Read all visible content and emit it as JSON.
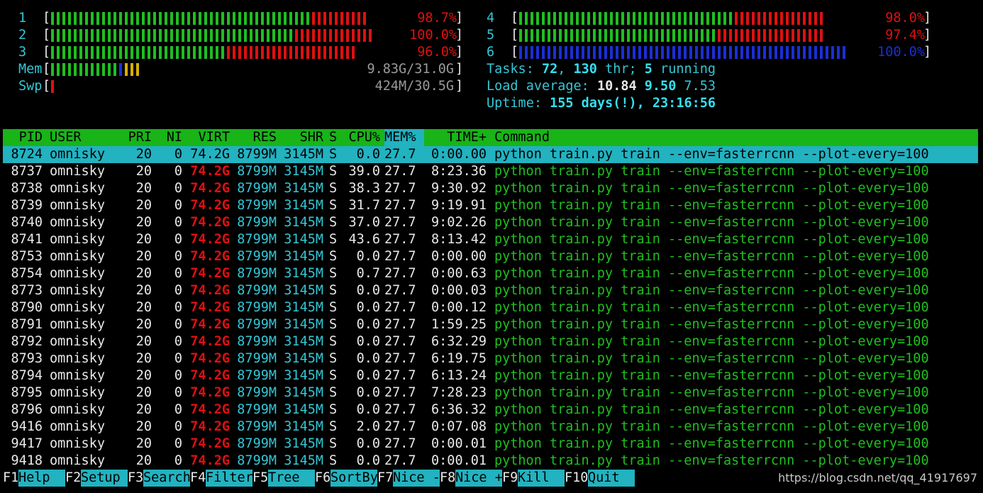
{
  "cpu_meters": [
    {
      "id": "1",
      "value_label": "98.7%",
      "percent": 98.7,
      "green_fraction": 0.81,
      "color_scheme": "green-red"
    },
    {
      "id": "2",
      "value_label": "100.0%",
      "percent": 100.0,
      "green_fraction": 0.76,
      "color_scheme": "green-red"
    },
    {
      "id": "3",
      "value_label": "96.0%",
      "percent": 96.0,
      "green_fraction": 0.55,
      "color_scheme": "green-red"
    },
    {
      "id": "4",
      "value_label": "98.0%",
      "percent": 98.0,
      "green_fraction": 0.69,
      "color_scheme": "green-red"
    },
    {
      "id": "5",
      "value_label": "97.4%",
      "percent": 97.4,
      "green_fraction": 0.63,
      "color_scheme": "green-red"
    },
    {
      "id": "6",
      "value_label": "100.0%",
      "percent": 100.0,
      "green_fraction": 0.0,
      "color_scheme": "blue"
    }
  ],
  "mem": {
    "label": "Mem",
    "value": "9.83G/31.0G",
    "green_fraction": 0.36,
    "blue_fraction": 0.01,
    "yellow_fraction": 0.08
  },
  "swap": {
    "label": "Swp",
    "value": "424M/30.5G",
    "red_fraction": 0.01
  },
  "tasks": {
    "label": "Tasks: ",
    "count": "72",
    "sep1": ", ",
    "threads": "130",
    "thr": " thr; ",
    "running": "5",
    "running_label": " running"
  },
  "load": {
    "label": "Load average: ",
    "l1": "10.84",
    "l5": "9.50",
    "l15": "7.53"
  },
  "uptime": {
    "label": "Uptime: ",
    "value": "155 days(!), 23:16:56"
  },
  "columns": [
    "PID",
    "USER",
    "PRI",
    "NI",
    "VIRT",
    "RES",
    "SHR",
    "S",
    "CPU%",
    "MEM%",
    "TIME+",
    "Command"
  ],
  "sort_column": "MEM%",
  "processes": [
    {
      "pid": "8724",
      "user": "omnisky",
      "pri": "20",
      "ni": "0",
      "virt": "74.2G",
      "res": "8799M",
      "shr": "3145M",
      "s": "S",
      "cpu": "0.0",
      "mem": "27.7",
      "time": "0:00.00",
      "cmd": "python train.py train --env=fasterrcnn --plot-every=100",
      "selected": true
    },
    {
      "pid": "8737",
      "user": "omnisky",
      "pri": "20",
      "ni": "0",
      "virt": "74.2G",
      "res": "8799M",
      "shr": "3145M",
      "s": "S",
      "cpu": "39.0",
      "mem": "27.7",
      "time": "8:23.36",
      "cmd": "python train.py train --env=fasterrcnn --plot-every=100"
    },
    {
      "pid": "8738",
      "user": "omnisky",
      "pri": "20",
      "ni": "0",
      "virt": "74.2G",
      "res": "8799M",
      "shr": "3145M",
      "s": "S",
      "cpu": "38.3",
      "mem": "27.7",
      "time": "9:30.92",
      "cmd": "python train.py train --env=fasterrcnn --plot-every=100"
    },
    {
      "pid": "8739",
      "user": "omnisky",
      "pri": "20",
      "ni": "0",
      "virt": "74.2G",
      "res": "8799M",
      "shr": "3145M",
      "s": "S",
      "cpu": "31.7",
      "mem": "27.7",
      "time": "9:19.91",
      "cmd": "python train.py train --env=fasterrcnn --plot-every=100"
    },
    {
      "pid": "8740",
      "user": "omnisky",
      "pri": "20",
      "ni": "0",
      "virt": "74.2G",
      "res": "8799M",
      "shr": "3145M",
      "s": "S",
      "cpu": "37.0",
      "mem": "27.7",
      "time": "9:02.26",
      "cmd": "python train.py train --env=fasterrcnn --plot-every=100"
    },
    {
      "pid": "8741",
      "user": "omnisky",
      "pri": "20",
      "ni": "0",
      "virt": "74.2G",
      "res": "8799M",
      "shr": "3145M",
      "s": "S",
      "cpu": "43.6",
      "mem": "27.7",
      "time": "8:13.42",
      "cmd": "python train.py train --env=fasterrcnn --plot-every=100"
    },
    {
      "pid": "8753",
      "user": "omnisky",
      "pri": "20",
      "ni": "0",
      "virt": "74.2G",
      "res": "8799M",
      "shr": "3145M",
      "s": "S",
      "cpu": "0.0",
      "mem": "27.7",
      "time": "0:00.00",
      "cmd": "python train.py train --env=fasterrcnn --plot-every=100"
    },
    {
      "pid": "8754",
      "user": "omnisky",
      "pri": "20",
      "ni": "0",
      "virt": "74.2G",
      "res": "8799M",
      "shr": "3145M",
      "s": "S",
      "cpu": "0.7",
      "mem": "27.7",
      "time": "0:00.63",
      "cmd": "python train.py train --env=fasterrcnn --plot-every=100"
    },
    {
      "pid": "8773",
      "user": "omnisky",
      "pri": "20",
      "ni": "0",
      "virt": "74.2G",
      "res": "8799M",
      "shr": "3145M",
      "s": "S",
      "cpu": "0.0",
      "mem": "27.7",
      "time": "0:00.03",
      "cmd": "python train.py train --env=fasterrcnn --plot-every=100"
    },
    {
      "pid": "8790",
      "user": "omnisky",
      "pri": "20",
      "ni": "0",
      "virt": "74.2G",
      "res": "8799M",
      "shr": "3145M",
      "s": "S",
      "cpu": "0.0",
      "mem": "27.7",
      "time": "0:00.12",
      "cmd": "python train.py train --env=fasterrcnn --plot-every=100"
    },
    {
      "pid": "8791",
      "user": "omnisky",
      "pri": "20",
      "ni": "0",
      "virt": "74.2G",
      "res": "8799M",
      "shr": "3145M",
      "s": "S",
      "cpu": "0.0",
      "mem": "27.7",
      "time": "1:59.25",
      "cmd": "python train.py train --env=fasterrcnn --plot-every=100"
    },
    {
      "pid": "8792",
      "user": "omnisky",
      "pri": "20",
      "ni": "0",
      "virt": "74.2G",
      "res": "8799M",
      "shr": "3145M",
      "s": "S",
      "cpu": "0.0",
      "mem": "27.7",
      "time": "6:32.29",
      "cmd": "python train.py train --env=fasterrcnn --plot-every=100"
    },
    {
      "pid": "8793",
      "user": "omnisky",
      "pri": "20",
      "ni": "0",
      "virt": "74.2G",
      "res": "8799M",
      "shr": "3145M",
      "s": "S",
      "cpu": "0.0",
      "mem": "27.7",
      "time": "6:19.75",
      "cmd": "python train.py train --env=fasterrcnn --plot-every=100"
    },
    {
      "pid": "8794",
      "user": "omnisky",
      "pri": "20",
      "ni": "0",
      "virt": "74.2G",
      "res": "8799M",
      "shr": "3145M",
      "s": "S",
      "cpu": "0.0",
      "mem": "27.7",
      "time": "6:13.24",
      "cmd": "python train.py train --env=fasterrcnn --plot-every=100"
    },
    {
      "pid": "8795",
      "user": "omnisky",
      "pri": "20",
      "ni": "0",
      "virt": "74.2G",
      "res": "8799M",
      "shr": "3145M",
      "s": "S",
      "cpu": "0.0",
      "mem": "27.7",
      "time": "7:28.23",
      "cmd": "python train.py train --env=fasterrcnn --plot-every=100"
    },
    {
      "pid": "8796",
      "user": "omnisky",
      "pri": "20",
      "ni": "0",
      "virt": "74.2G",
      "res": "8799M",
      "shr": "3145M",
      "s": "S",
      "cpu": "0.0",
      "mem": "27.7",
      "time": "6:36.32",
      "cmd": "python train.py train --env=fasterrcnn --plot-every=100"
    },
    {
      "pid": "9416",
      "user": "omnisky",
      "pri": "20",
      "ni": "0",
      "virt": "74.2G",
      "res": "8799M",
      "shr": "3145M",
      "s": "S",
      "cpu": "2.0",
      "mem": "27.7",
      "time": "0:07.08",
      "cmd": "python train.py train --env=fasterrcnn --plot-every=100"
    },
    {
      "pid": "9417",
      "user": "omnisky",
      "pri": "20",
      "ni": "0",
      "virt": "74.2G",
      "res": "8799M",
      "shr": "3145M",
      "s": "S",
      "cpu": "0.0",
      "mem": "27.7",
      "time": "0:00.01",
      "cmd": "python train.py train --env=fasterrcnn --plot-every=100"
    },
    {
      "pid": "9418",
      "user": "omnisky",
      "pri": "20",
      "ni": "0",
      "virt": "74.2G",
      "res": "8799M",
      "shr": "3145M",
      "s": "S",
      "cpu": "0.0",
      "mem": "27.7",
      "time": "0:00.01",
      "cmd": "python train.py train --env=fasterrcnn --plot-every=100"
    }
  ],
  "function_keys": [
    {
      "key": "F1",
      "label": "Help  "
    },
    {
      "key": "F2",
      "label": "Setup "
    },
    {
      "key": "F3",
      "label": "Search"
    },
    {
      "key": "F4",
      "label": "Filter"
    },
    {
      "key": "F5",
      "label": "Tree  "
    },
    {
      "key": "F6",
      "label": "SortBy"
    },
    {
      "key": "F7",
      "label": "Nice -"
    },
    {
      "key": "F8",
      "label": "Nice +"
    },
    {
      "key": "F9",
      "label": "Kill  "
    },
    {
      "key": "F10",
      "label": "Quit  "
    }
  ],
  "watermark": "https://blog.csdn.net/qq_41917697",
  "colors": {
    "green": "#1fbf1f",
    "red": "#e01010",
    "blue": "#1a2fd8",
    "cyan": "#33c7d6",
    "yellow": "#d8b000",
    "header_bg": "#18b418",
    "selection_bg": "#22b2c0"
  }
}
